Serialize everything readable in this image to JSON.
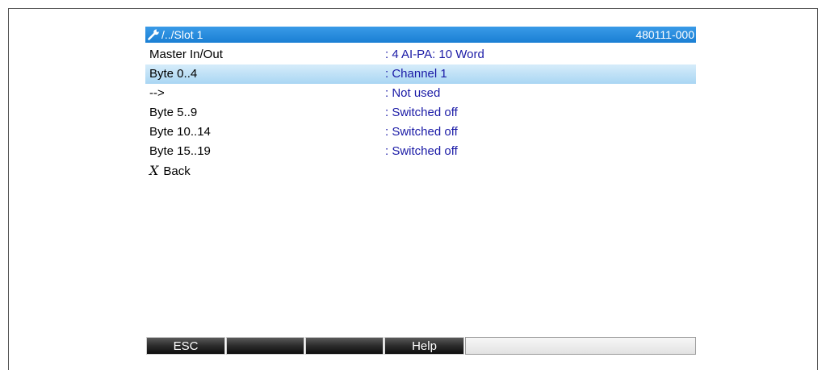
{
  "header": {
    "icon": "wrench-icon",
    "path": "/../Slot 1",
    "code": "480111-000",
    "color": "#1a7fd4"
  },
  "menu": {
    "rows": [
      {
        "label": "Master In/Out",
        "value": ": 4 AI-PA: 10 Word"
      },
      {
        "label": "Byte 0..4",
        "value": ": Channel 1"
      },
      {
        "label": "-->",
        "value": ": Not used"
      },
      {
        "label": "Byte 5..9",
        "value": ": Switched off"
      },
      {
        "label": "Byte 10..14",
        "value": ": Switched off"
      },
      {
        "label": "Byte 15..19",
        "value": ": Switched off"
      }
    ],
    "back": {
      "icon": "x-icon",
      "glyph": "X",
      "label": "Back"
    },
    "value_color": "#1a1aa6",
    "selected_color": "#a9d6f3"
  },
  "softkeys": {
    "esc": "ESC",
    "key2": "",
    "key3": "",
    "help": "Help",
    "key5": ""
  }
}
